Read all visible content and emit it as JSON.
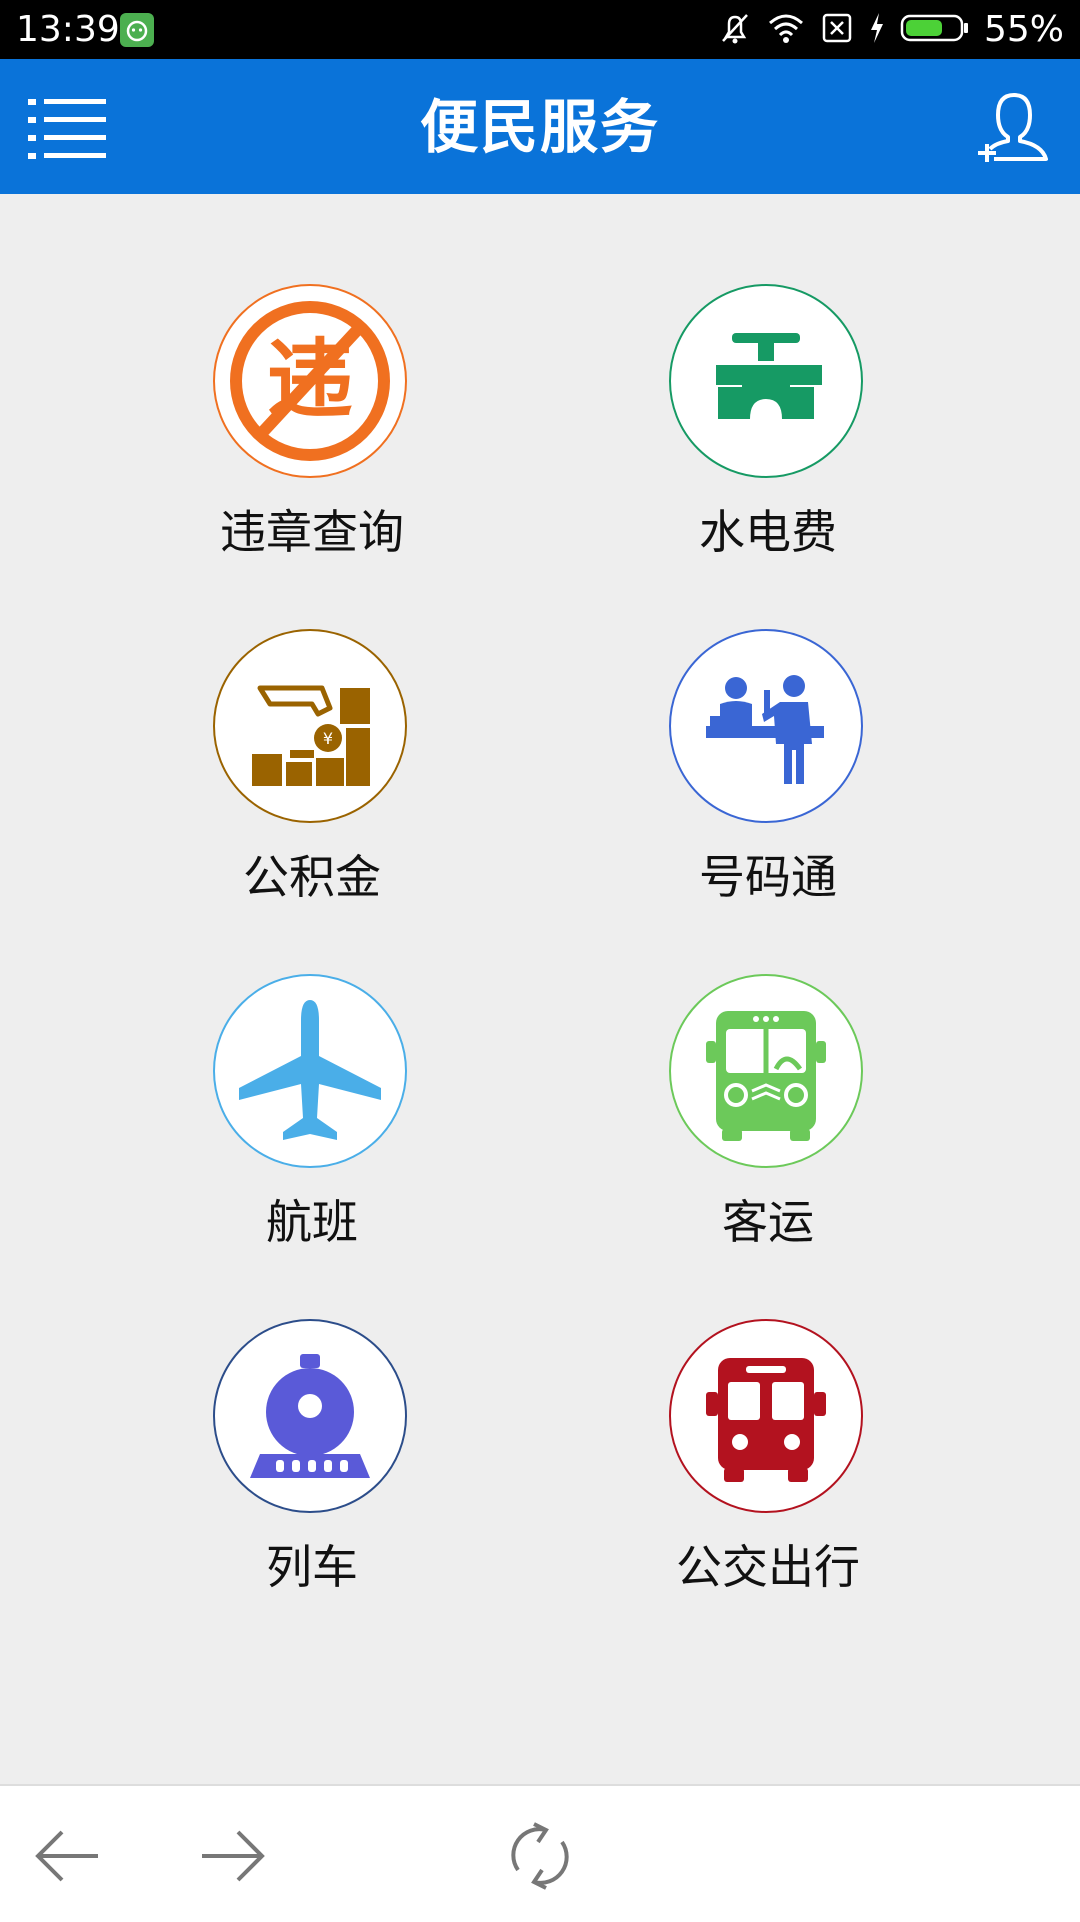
{
  "status_bar": {
    "time": "13:39",
    "battery_percent": "55%",
    "icons": [
      "notification-app-icon",
      "mute-bell-icon",
      "wifi-icon",
      "no-sim-icon",
      "charging-icon",
      "battery-icon"
    ]
  },
  "header": {
    "title": "便民服务",
    "menu_icon": "list-menu-icon",
    "user_icon": "add-user-icon",
    "color": "#0a73d9"
  },
  "services": [
    {
      "label": "违章查询",
      "icon": "traffic-violation-icon",
      "color": "#f07020"
    },
    {
      "label": "水电费",
      "icon": "water-tap-icon",
      "color": "#169a64"
    },
    {
      "label": "公积金",
      "icon": "housing-fund-icon",
      "color": "#9a6300"
    },
    {
      "label": "号码通",
      "icon": "service-counter-icon",
      "color": "#3a66d4"
    },
    {
      "label": "航班",
      "icon": "airplane-icon",
      "color": "#4aaee8"
    },
    {
      "label": "客运",
      "icon": "coach-bus-icon",
      "color": "#6cc95a"
    },
    {
      "label": "列车",
      "icon": "train-icon",
      "color": "#5a5ad8"
    },
    {
      "label": "公交出行",
      "icon": "city-bus-icon",
      "color": "#b3121f"
    }
  ],
  "bottom_nav": {
    "back_icon": "arrow-left-icon",
    "forward_icon": "arrow-right-icon",
    "refresh_icon": "refresh-icon"
  }
}
